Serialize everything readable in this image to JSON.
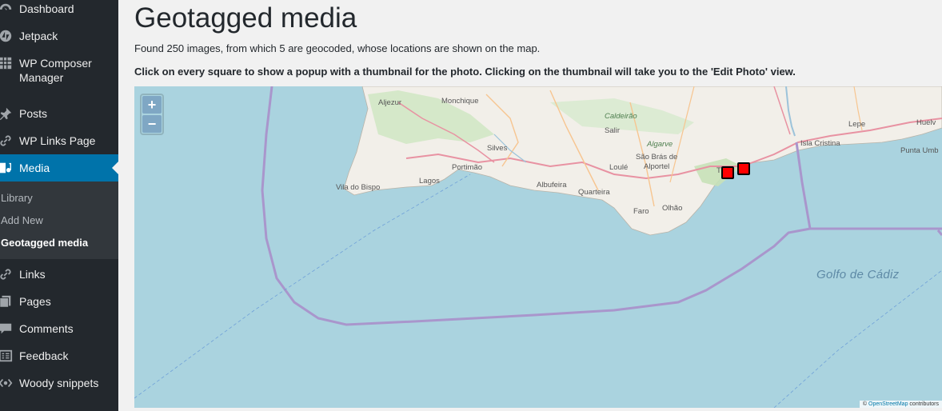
{
  "sidebar": {
    "items": [
      {
        "label": "Dashboard",
        "icon": "dashboard-icon"
      },
      {
        "label": "Jetpack",
        "icon": "jetpack-icon"
      },
      {
        "label": "WP Composer Manager",
        "icon": "grid-icon"
      },
      {
        "label": "Posts",
        "icon": "pin-icon"
      },
      {
        "label": "WP Links Page",
        "icon": "link-icon"
      },
      {
        "label": "Media",
        "icon": "media-icon",
        "active": true
      },
      {
        "label": "Links",
        "icon": "link-icon"
      },
      {
        "label": "Pages",
        "icon": "pages-icon"
      },
      {
        "label": "Comments",
        "icon": "comments-icon"
      },
      {
        "label": "Feedback",
        "icon": "feedback-icon"
      },
      {
        "label": "Woody snippets",
        "icon": "snippets-icon"
      }
    ],
    "media_submenu": [
      {
        "label": "Library"
      },
      {
        "label": "Add New"
      },
      {
        "label": "Geotagged media",
        "current": true
      }
    ]
  },
  "main": {
    "title": "Geotagged media",
    "summary": "Found 250 images, from which 5 are geocoded, whose locations are shown on the map.",
    "instructions": "Click on every square to show a popup with a thumbnail for the photo. Clicking on the thumbnail will take you to the 'Edit Photo' view."
  },
  "map": {
    "zoom_in": "+",
    "zoom_out": "−",
    "labels": {
      "aljezur": "Aljezur",
      "monchique": "Monchique",
      "caldeirao": "Caldeirão",
      "salir": "Salir",
      "algarve": "Algarve",
      "silves": "Silves",
      "sao_bras": "São Brás de",
      "alportel": "Alportel",
      "loule": "Loulé",
      "portimao": "Portimão",
      "vila_do_bispo": "Vila do Bispo",
      "lagos": "Lagos",
      "albufeira": "Albufeira",
      "quarteira": "Quarteira",
      "faro": "Faro",
      "olhao": "Olhão",
      "lepe": "Lepe",
      "huelva": "Huelv",
      "isla_cristina": "Isla Cristina",
      "punta_umbria": "Punta Umb",
      "golfo": "Golfo de Cádiz",
      "tavira_partial": "T"
    },
    "attribution_prefix": "©",
    "attribution_link": "OpenStreetMap",
    "attribution_suffix": "contributors",
    "colors": {
      "sea": "#aad3df",
      "land": "#f2efe9",
      "boundary": "#a996cc",
      "marker": "#ff0000"
    }
  }
}
